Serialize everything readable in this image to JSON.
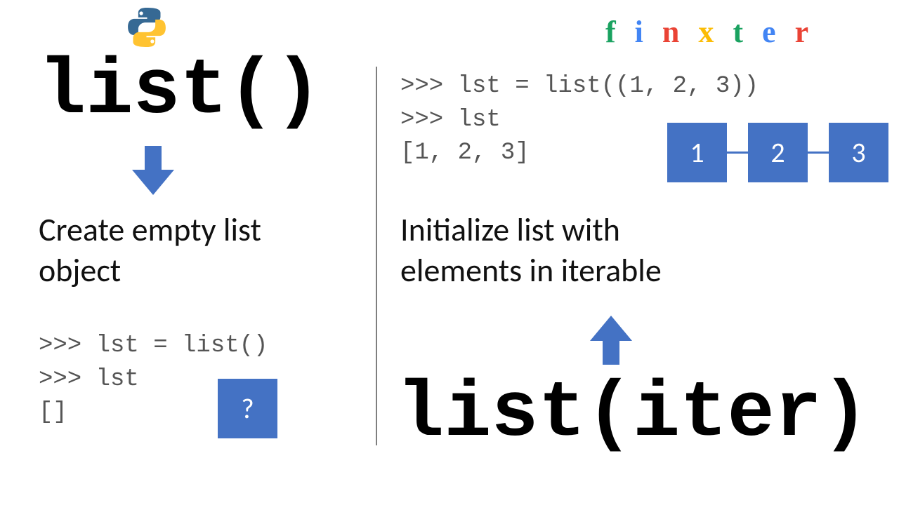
{
  "brand": {
    "letters": [
      "f",
      "i",
      "n",
      "x",
      "t",
      "e",
      "r"
    ],
    "colors": [
      "#1aa260",
      "#4285f4",
      "#ea4335",
      "#fbbc05",
      "#1aa260",
      "#4285f4",
      "#ea4335"
    ]
  },
  "left": {
    "title": "list()",
    "description": "Create empty list\nobject",
    "code": ">>> lst = list()\n>>> lst\n[]",
    "empty_box_label": "?"
  },
  "right": {
    "title": "list(iter)",
    "description": "Initialize list with\nelements in iterable",
    "code": ">>> lst = list((1, 2, 3))\n>>> lst\n[1, 2, 3]",
    "nodes": [
      "1",
      "2",
      "3"
    ]
  },
  "colors": {
    "accent": "#4472c4"
  }
}
